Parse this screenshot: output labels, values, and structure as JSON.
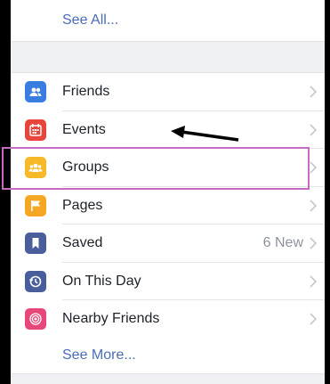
{
  "links": {
    "see_all": "See All...",
    "see_more": "See More..."
  },
  "menu": {
    "items": [
      {
        "label": "Friends",
        "icon": "friends-icon",
        "color": "#3a7de0"
      },
      {
        "label": "Events",
        "icon": "calendar-icon",
        "color": "#e8453c"
      },
      {
        "label": "Groups",
        "icon": "groups-icon",
        "color": "#f7b928"
      },
      {
        "label": "Pages",
        "icon": "flag-icon",
        "color": "#f5a623"
      },
      {
        "label": "Saved",
        "icon": "bookmark-icon",
        "color": "#4a5e9b",
        "badge": "6 New"
      },
      {
        "label": "On This Day",
        "icon": "clock-icon",
        "color": "#4a5e9b"
      },
      {
        "label": "Nearby Friends",
        "icon": "nearby-icon",
        "color": "#e8477a"
      }
    ]
  },
  "annotation": {
    "highlight_color": "#c76bc2",
    "arrow_color": "#000000"
  },
  "colors": {
    "link": "#4a6db6",
    "text": "#1d2129",
    "muted": "#8d949e",
    "divider_bg": "#eef0f4"
  }
}
